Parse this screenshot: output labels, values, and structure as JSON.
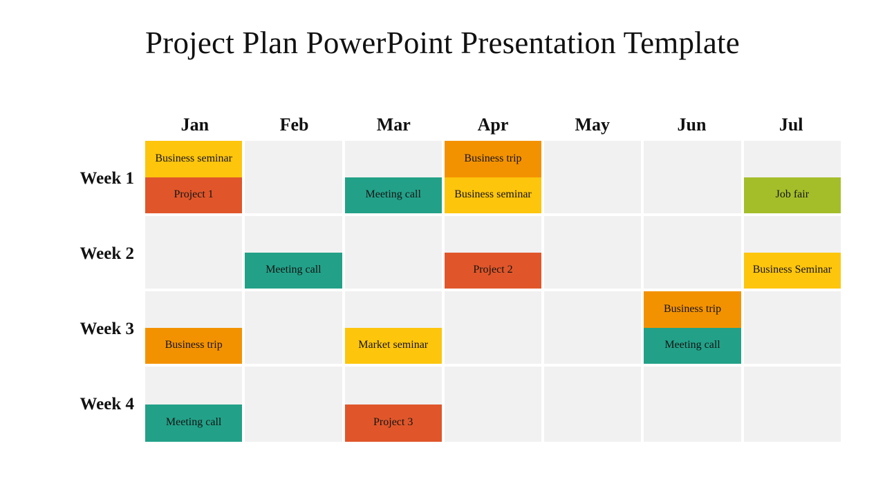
{
  "title": "Project Plan PowerPoint Presentation Template",
  "colors": {
    "background": "#ffffff",
    "cell_empty": "#f1f1f1",
    "grid_gap": "#ffffff",
    "text": "#111111",
    "yellow": "#fdc50c",
    "orange": "#f39200",
    "red": "#e0562a",
    "teal": "#22a188",
    "olive": "#a4be2a"
  },
  "months": [
    "Jan",
    "Feb",
    "Mar",
    "Apr",
    "May",
    "Jun",
    "Jul"
  ],
  "weeks": [
    "Week 1",
    "Week 2",
    "Week 3",
    "Week 4"
  ],
  "legend_tasks": [
    {
      "label": "Business seminar",
      "color": "#fdc50c"
    },
    {
      "label": "Business trip",
      "color": "#f39200"
    },
    {
      "label": "Project",
      "color": "#e0562a"
    },
    {
      "label": "Meeting call",
      "color": "#22a188"
    },
    {
      "label": "Job fair",
      "color": "#a4be2a"
    },
    {
      "label": "Market seminar",
      "color": "#fdc50c"
    }
  ],
  "chart_data": {
    "type": "table",
    "title": "Project Plan PowerPoint Presentation Template",
    "xlabel": "",
    "ylabel": "",
    "categories": [
      "Jan",
      "Feb",
      "Mar",
      "Apr",
      "May",
      "Jun",
      "Jul"
    ],
    "rows": [
      "Week 1",
      "Week 2",
      "Week 3",
      "Week 4"
    ],
    "cells": [
      [
        {
          "top": {
            "label": "Business seminar",
            "color": "#fdc50c"
          },
          "bottom": {
            "label": "Project 1",
            "color": "#e0562a"
          }
        },
        {
          "top": null,
          "bottom": null
        },
        {
          "top": null,
          "bottom": {
            "label": "Meeting call",
            "color": "#22a188"
          }
        },
        {
          "top": {
            "label": "Business trip",
            "color": "#f39200"
          },
          "bottom": {
            "label": "Business seminar",
            "color": "#fdc50c"
          }
        },
        {
          "top": null,
          "bottom": null
        },
        {
          "top": null,
          "bottom": null
        },
        {
          "top": null,
          "bottom": {
            "label": "Job fair",
            "color": "#a4be2a"
          }
        }
      ],
      [
        {
          "top": null,
          "bottom": null
        },
        {
          "top": null,
          "bottom": {
            "label": "Meeting call",
            "color": "#22a188"
          }
        },
        {
          "top": null,
          "bottom": null
        },
        {
          "top": null,
          "bottom": {
            "label": "Project 2",
            "color": "#e0562a"
          }
        },
        {
          "top": null,
          "bottom": null
        },
        {
          "top": null,
          "bottom": null
        },
        {
          "top": null,
          "bottom": {
            "label": "Business Seminar",
            "color": "#fdc50c"
          }
        }
      ],
      [
        {
          "top": null,
          "bottom": {
            "label": "Business trip",
            "color": "#f39200"
          }
        },
        {
          "top": null,
          "bottom": null
        },
        {
          "top": null,
          "bottom": {
            "label": "Market seminar",
            "color": "#fdc50c"
          }
        },
        {
          "top": null,
          "bottom": null
        },
        {
          "top": null,
          "bottom": null
        },
        {
          "top": {
            "label": "Business trip",
            "color": "#f39200"
          },
          "bottom": {
            "label": "Meeting call",
            "color": "#22a188"
          }
        },
        {
          "top": null,
          "bottom": null
        }
      ],
      [
        {
          "top": null,
          "bottom": {
            "label": "Meeting call",
            "color": "#22a188"
          }
        },
        {
          "top": null,
          "bottom": null
        },
        {
          "top": null,
          "bottom": {
            "label": "Project 3",
            "color": "#e0562a"
          }
        },
        {
          "top": null,
          "bottom": null
        },
        {
          "top": null,
          "bottom": null
        },
        {
          "top": null,
          "bottom": null
        },
        {
          "top": null,
          "bottom": null
        }
      ]
    ]
  }
}
